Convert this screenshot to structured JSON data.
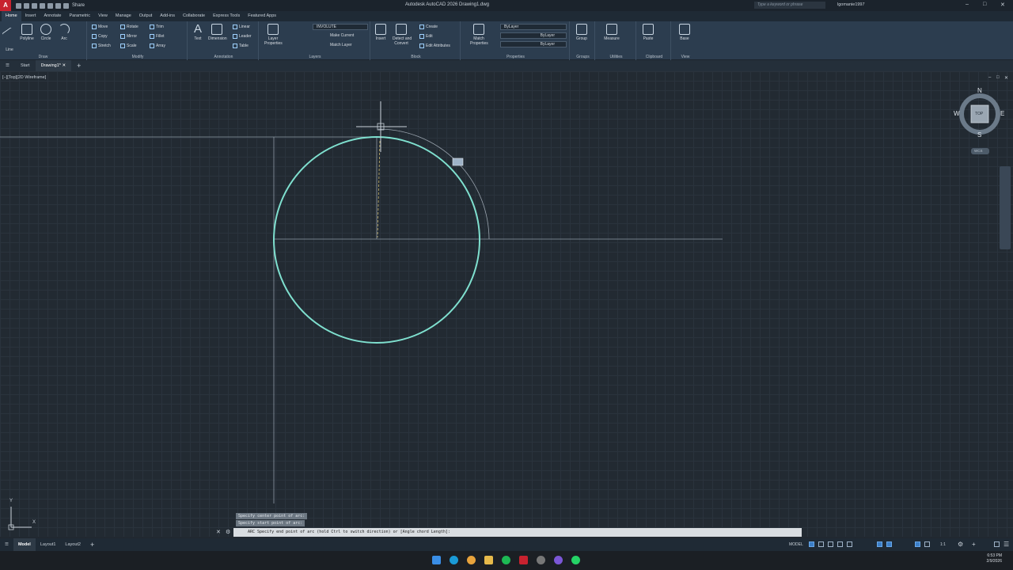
{
  "title_bar": {
    "app_letter": "A",
    "share_label": "Share",
    "window_title": "Autodesk AutoCAD 2026   Drawing1.dwg",
    "search_placeholder": "Type a keyword or phrase",
    "user_name": "lgomanie1997"
  },
  "ribbon_tabs": [
    "Home",
    "Insert",
    "Annotate",
    "Parametric",
    "View",
    "Manage",
    "Output",
    "Add-ins",
    "Collaborate",
    "Express Tools",
    "Featured Apps"
  ],
  "ribbon": {
    "draw": {
      "title": "Draw",
      "line": "Line",
      "polyline": "Polyline",
      "circle": "Circle",
      "arc": "Arc"
    },
    "modify": {
      "title": "Modify",
      "move": "Move",
      "rotate": "Rotate",
      "trim": "Trim",
      "copy": "Copy",
      "mirror": "Mirror",
      "fillet": "Fillet",
      "stretch": "Stretch",
      "scale": "Scale",
      "array": "Array"
    },
    "annotation": {
      "title": "Annotation",
      "text": "Text",
      "dimension": "Dimension",
      "linear": "Linear",
      "leader": "Leader",
      "table": "Table"
    },
    "layers": {
      "title": "Layers",
      "layer_properties_1": "Layer",
      "layer_properties_2": "Properties",
      "current_layer": "INVOLUTE",
      "make_current": "Make Current",
      "match_layer": "Match Layer"
    },
    "block": {
      "title": "Block",
      "insert": "Insert",
      "create": "Create",
      "edit": "Edit",
      "edit_attributes": "Edit Attributes",
      "detect_1": "Detect and",
      "detect_2": "Convert"
    },
    "properties": {
      "title": "Properties",
      "match_1": "Match",
      "match_2": "Properties",
      "color": "ByLayer",
      "linetype": "ByLayer",
      "lineweight": "ByLayer"
    },
    "groups": {
      "title": "Groups",
      "group": "Group"
    },
    "utilities": {
      "title": "Utilities",
      "measure": "Measure"
    },
    "clipboard": {
      "title": "Clipboard",
      "paste": "Paste"
    },
    "view": {
      "title": "View",
      "base": "Base"
    }
  },
  "doc_tabs": {
    "start": "Start",
    "drawing": "Drawing1*"
  },
  "viewport_label": "[−][Top][2D Wireframe]",
  "viewcube": {
    "n": "N",
    "s": "S",
    "e": "E",
    "w": "W",
    "face": "TOP",
    "ucs": "WCS"
  },
  "ucs_icon": {
    "x": "X",
    "y": "Y"
  },
  "command": {
    "history_1": "Specify center point of arc:",
    "history_2": "Specify start point of arc:",
    "prompt": "ARC Specify end point of arc (hold Ctrl to switch direction) or [Angle chord Length]:"
  },
  "layout_tabs": [
    "Model",
    "Layout1",
    "Layout2"
  ],
  "status": {
    "model": "MODEL",
    "scale": "1:1"
  },
  "clock": {
    "time": "6:53 PM",
    "date": "2/9/2026"
  },
  "colors": {
    "circle": "#7fe0cf",
    "accent": "#3c7fc8",
    "app_red": "#c8222f"
  }
}
